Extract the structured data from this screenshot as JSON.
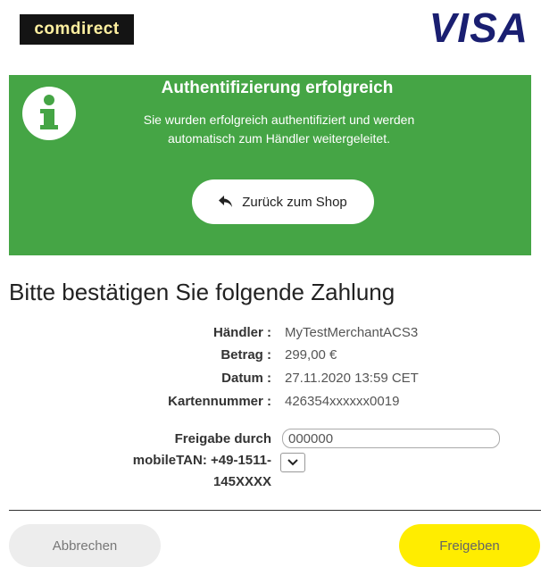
{
  "header": {
    "bank_logo_text": "comdirect",
    "card_logo_text": "VISA"
  },
  "banner": {
    "title": "Authentifizierung erfolgreich",
    "message_line1": "Sie wurden erfolgreich authentifiziert und werden",
    "message_line2": "automatisch zum Händler weitergeleitet.",
    "back_button_label": "Zurück zum Shop",
    "color": "#45a545"
  },
  "page": {
    "title": "Bitte bestätigen Sie folgende Zahlung"
  },
  "payment": {
    "merchant_label": "Händler :",
    "merchant_value": "MyTestMerchantACS3",
    "amount_label": "Betrag :",
    "amount_value": "299,00 €",
    "date_label": "Datum :",
    "date_value": "27.11.2020 13:59 CET",
    "card_label": "Kartennummer :",
    "card_value": "426354xxxxxx0019"
  },
  "tan": {
    "label_line1": "Freigabe durch",
    "label_line2": "mobileTAN: +49-1511-",
    "label_line3": "145XXXX",
    "input_value": "000000"
  },
  "actions": {
    "cancel_label": "Abbrechen",
    "confirm_label": "Freigeben",
    "confirm_color": "#ffed00"
  }
}
